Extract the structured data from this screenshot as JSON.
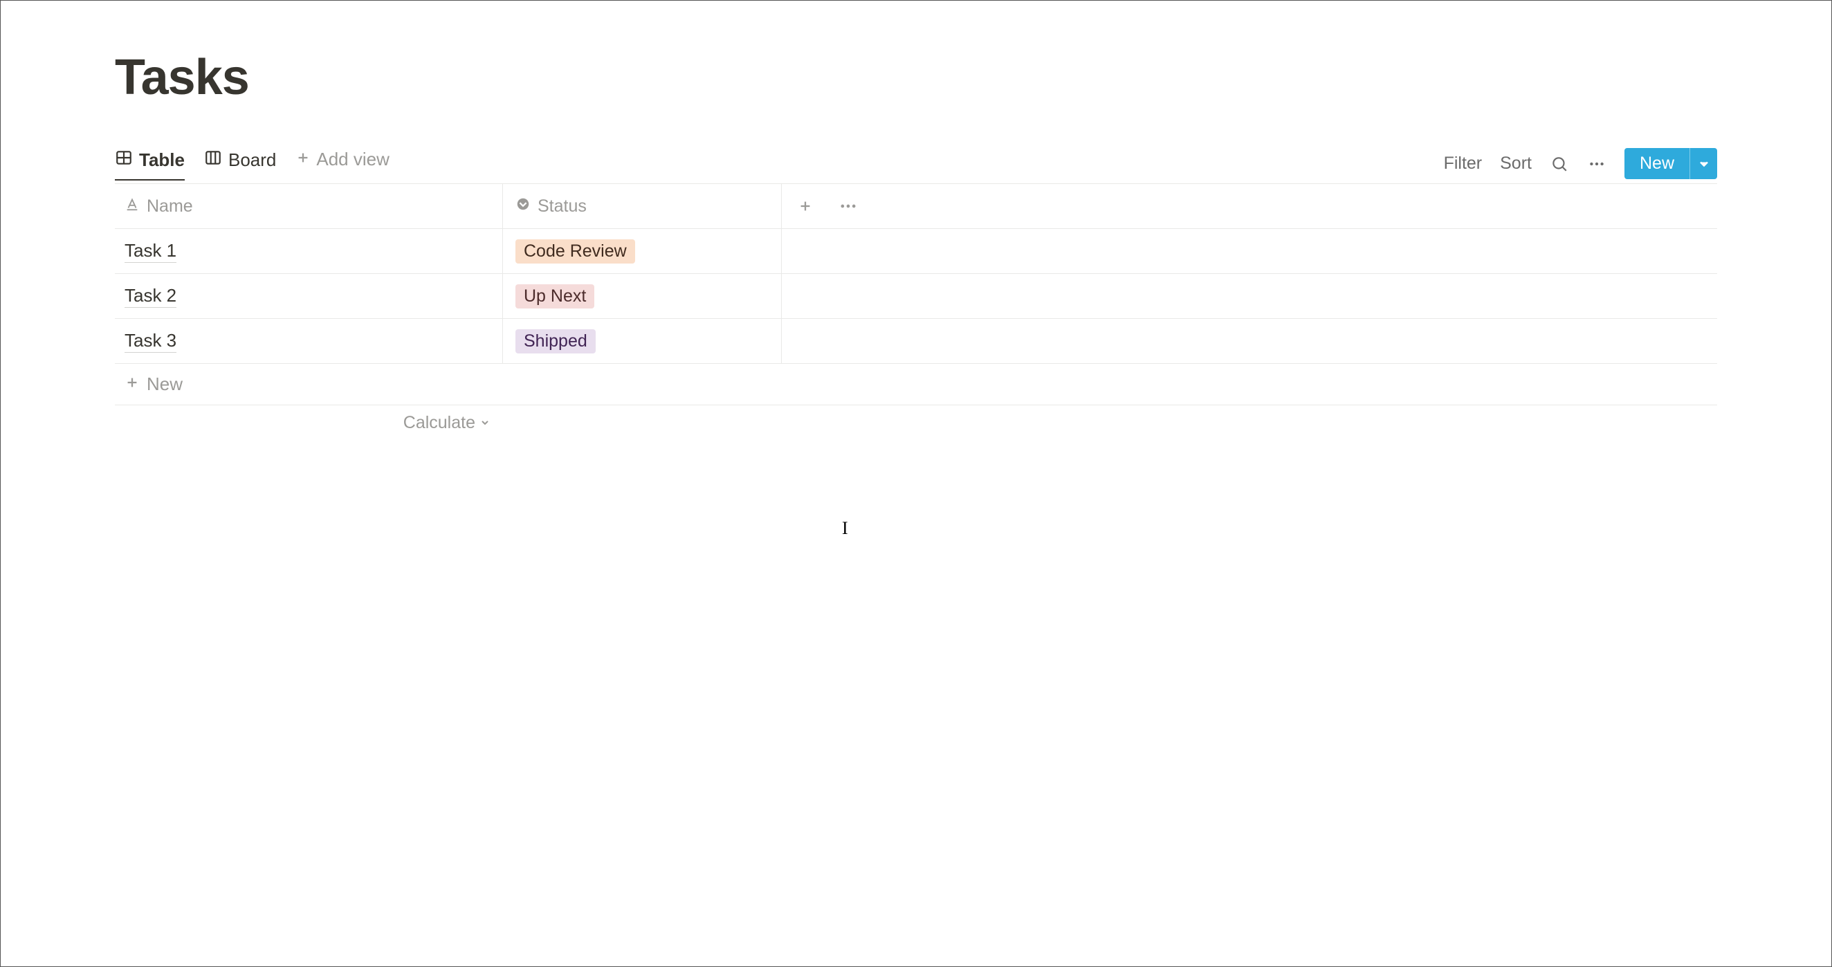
{
  "page": {
    "title": "Tasks"
  },
  "tabs": {
    "table": "Table",
    "board": "Board",
    "add_view": "Add view"
  },
  "toolbar": {
    "filter": "Filter",
    "sort": "Sort",
    "new": "New"
  },
  "columns": {
    "name": "Name",
    "status": "Status"
  },
  "rows": [
    {
      "name": "Task 1",
      "status": "Code Review",
      "status_style": "orange"
    },
    {
      "name": "Task 2",
      "status": "Up Next",
      "status_style": "pink"
    },
    {
      "name": "Task 3",
      "status": "Shipped",
      "status_style": "purple"
    }
  ],
  "footer": {
    "new_row": "New",
    "calculate": "Calculate"
  }
}
